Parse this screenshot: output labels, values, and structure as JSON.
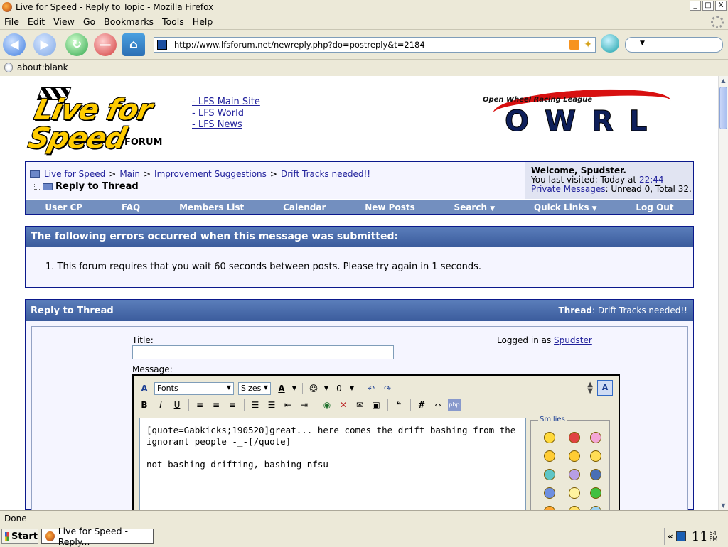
{
  "window": {
    "title": "Live for Speed - Reply to Topic - Mozilla Firefox",
    "min": "_",
    "max": "□",
    "close": "X"
  },
  "menu": [
    "File",
    "Edit",
    "View",
    "Go",
    "Bookmarks",
    "Tools",
    "Help"
  ],
  "toolbar": {
    "url": "http://www.lfsforum.net/newreply.php?do=postreply&t=2184"
  },
  "bookmarks": {
    "label": "about:blank"
  },
  "header": {
    "logo_text": "Live for Speed",
    "logo_sub": "FORUM",
    "links": [
      "- LFS Main Site",
      "- LFS World",
      "- LFS News"
    ],
    "owrl_sub": "Open Wheel Racing League",
    "owrl_main": "OWRL"
  },
  "breadcrumb": {
    "items": [
      "Live for Speed",
      "Main",
      "Improvement Suggestions",
      "Drift Tracks needed!!"
    ],
    "sep": ">",
    "current": "Reply to Thread"
  },
  "welcome": {
    "title": "Welcome, Spudster.",
    "visited_prefix": "You last visited: Today at ",
    "visited_time": "22:44",
    "pm_link": "Private Messages",
    "pm_status": ": Unread 0, Total 32."
  },
  "nav": {
    "items": [
      "User CP",
      "FAQ",
      "Members List",
      "Calendar",
      "New Posts",
      "Search",
      "Quick Links",
      "Log Out"
    ],
    "dropdown_mark": "▼"
  },
  "errors": {
    "heading": "The following errors occurred when this message was submitted:",
    "items": [
      "1.  This forum requires that you wait 60 seconds between posts. Please try again in 1 seconds."
    ]
  },
  "reply": {
    "heading": "Reply to Thread",
    "thread_label": "Thread",
    "thread_title": ": Drift Tracks needed!!",
    "title_label": "Title:",
    "logged_prefix": "Logged in as ",
    "logged_user": "Spudster",
    "message_label": "Message:",
    "fonts": "Fonts",
    "sizes": "Sizes",
    "message_text": "[quote=Gabkicks;190520]great... here comes the drift bashing from the ignorant people -_-[/quote]\n\nnot bashing drifting, bashing nfsu",
    "smilies_label": "Smilies"
  },
  "status": {
    "text": "Done"
  },
  "taskbar": {
    "start": "Start",
    "item": "Live for Speed - Reply...",
    "clock": "11",
    "clock_min": "54",
    "clock_pm": "PM",
    "tray_chev": "«"
  },
  "colors": {
    "accent": "#3b5c9d",
    "nav_strip": "#738fbf",
    "link": "#22229c"
  }
}
